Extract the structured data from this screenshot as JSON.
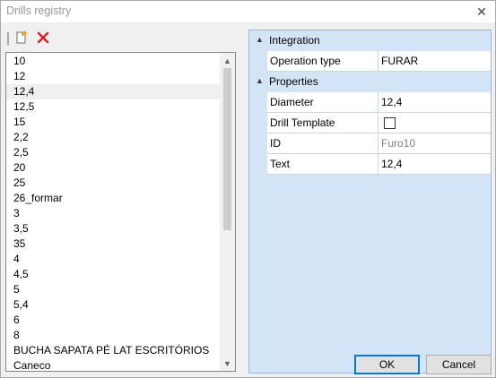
{
  "window": {
    "title": "Drills registry",
    "close_glyph": "✕"
  },
  "toolbar": {
    "new_icon": "new-document-icon",
    "delete_icon": "delete-x-icon",
    "accent_delete": "#e0201a"
  },
  "list": {
    "items": [
      "10",
      "12",
      "12,4",
      "12,5",
      "15",
      "2,2",
      "2,5",
      "20",
      "25",
      "26_formar",
      "3",
      "3,5",
      "35",
      "4",
      "4,5",
      "5",
      "5,4",
      "6",
      "8",
      "BUCHA SAPATA PÉ LAT ESCRITÓRIOS",
      "Caneco"
    ],
    "selected_index": 2
  },
  "propgrid": {
    "categories": [
      {
        "label": "Integration",
        "properties": [
          {
            "name": "Operation type",
            "value": "FURAR"
          }
        ]
      },
      {
        "label": "Properties",
        "properties": [
          {
            "name": "Diameter",
            "value": "12,4"
          },
          {
            "name": "Drill Template",
            "value": ""
          },
          {
            "name": "ID",
            "value": "Furo10"
          },
          {
            "name": "Text",
            "value": "12,4"
          }
        ]
      }
    ],
    "drill_template_checked": false
  },
  "buttons": {
    "ok": "OK",
    "cancel": "Cancel"
  },
  "colors": {
    "grid_bg": "#d4e4f7",
    "focus_border": "#0078d7"
  }
}
